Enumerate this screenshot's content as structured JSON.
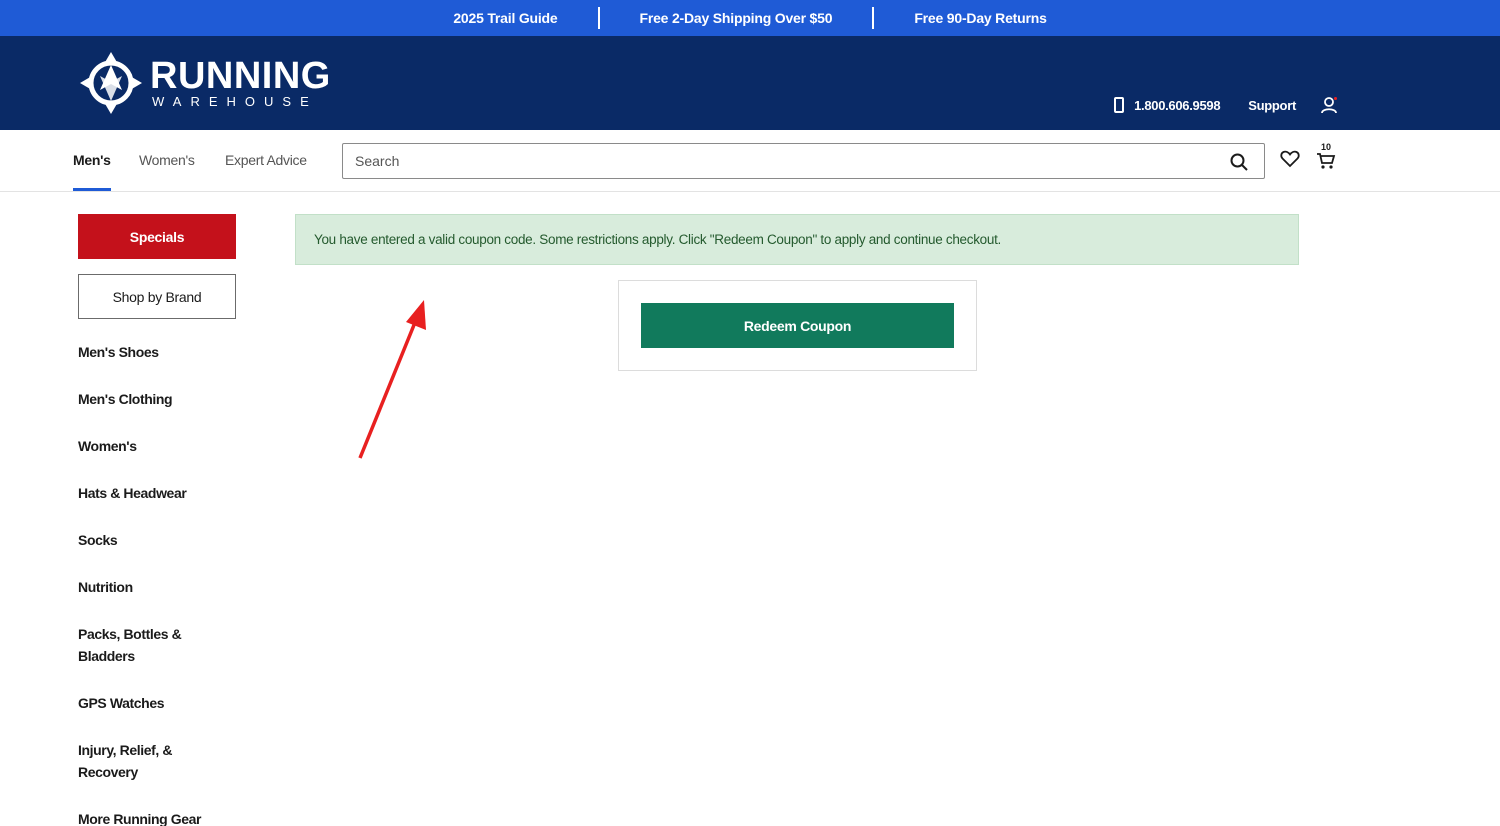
{
  "promo": {
    "items": [
      "2025 Trail Guide",
      "Free 2-Day Shipping Over $50",
      "Free 90-Day Returns"
    ]
  },
  "header": {
    "logo_main": "RUNNING",
    "logo_sub": "WAREHOUSE",
    "phone": "1.800.606.9598",
    "support_label": "Support",
    "icons": [
      "phone-icon",
      "user-icon"
    ]
  },
  "nav": {
    "tabs": [
      {
        "label": "Men's",
        "active": true
      },
      {
        "label": "Women's",
        "active": false
      },
      {
        "label": "Expert Advice",
        "active": false
      }
    ],
    "search": {
      "placeholder": "Search",
      "value": ""
    },
    "cart_count": "10",
    "icons": [
      "search-icon",
      "heart-icon",
      "cart-icon"
    ]
  },
  "sidebar": {
    "specials_label": "Specials",
    "brand_label": "Shop by Brand",
    "items": [
      "Men's Shoes",
      "Men's Clothing",
      "Women's",
      "Hats & Headwear",
      "Socks",
      "Nutrition",
      "Packs, Bottles & Bladders",
      "GPS Watches",
      "Injury, Relief, & Recovery",
      "More Running Gear"
    ]
  },
  "main": {
    "alert_text": "You have entered a valid coupon code. Some restrictions apply. Click \"Redeem Coupon\" to apply and continue checkout.",
    "redeem_label": "Redeem Coupon"
  },
  "colors": {
    "promo_bar": "#1f5bd6",
    "header_bg": "#0a2a66",
    "specials": "#c4111b",
    "redeem": "#117a5c",
    "alert_bg": "#d8ecdc",
    "annotation": "#e82020"
  }
}
